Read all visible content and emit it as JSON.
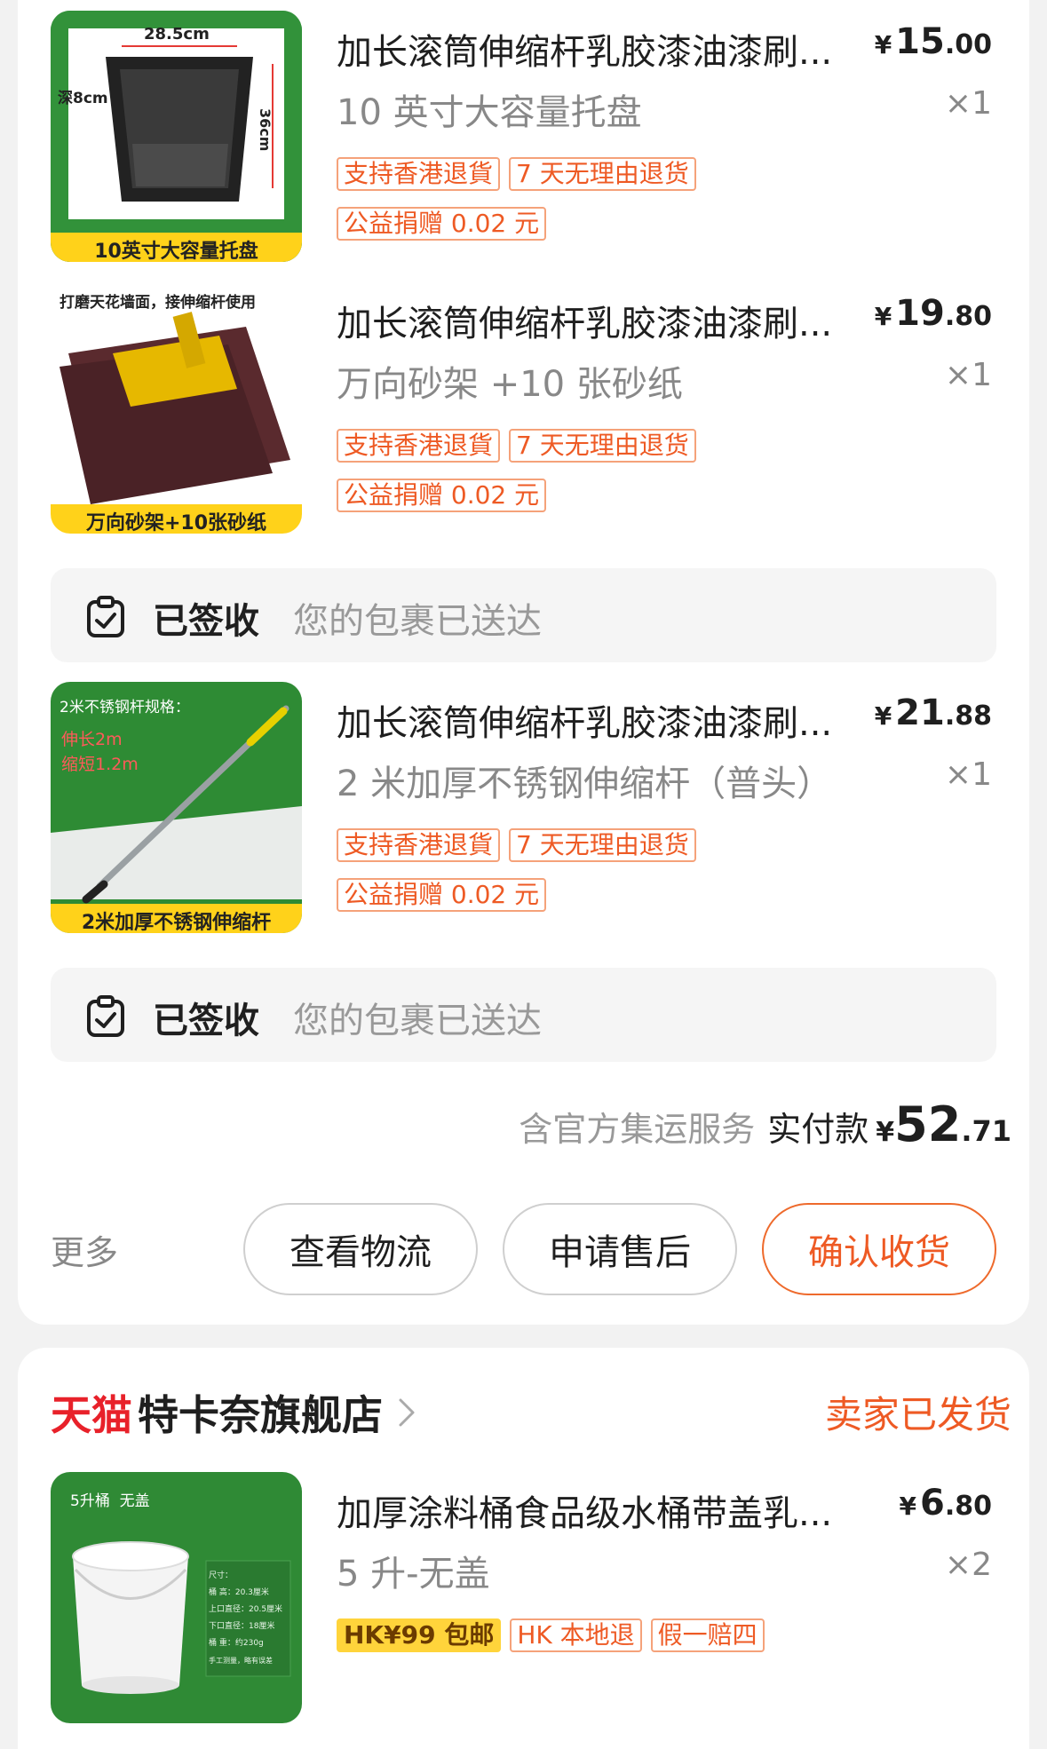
{
  "items": [
    {
      "title": "加长滚筒伸缩杆乳胶漆油漆刷...",
      "price_currency": "¥",
      "price_int": "15",
      "price_dec": ".00",
      "spec": "10 英寸大容量托盘",
      "qty": "×1",
      "tags": [
        "支持香港退貨",
        "7 天无理由退货",
        "公益捐赠 0.02 元"
      ],
      "thumb_text_top": "28.5cm",
      "thumb_text_side": "深8cm",
      "thumb_text_right": "36cm",
      "thumb_caption": "10英寸大容量托盘"
    },
    {
      "title": "加长滚筒伸缩杆乳胶漆油漆刷...",
      "price_currency": "¥",
      "price_int": "19",
      "price_dec": ".80",
      "spec": "万向砂架 +10 张砂纸",
      "qty": "×1",
      "tags": [
        "支持香港退貨",
        "7 天无理由退货",
        "公益捐赠 0.02 元"
      ],
      "thumb_text_top": "打磨天花墙面，接伸缩杆使用",
      "thumb_caption": "万向砂架+10张砂纸"
    },
    {
      "title": "加长滚筒伸缩杆乳胶漆油漆刷...",
      "price_currency": "¥",
      "price_int": "21",
      "price_dec": ".88",
      "spec": "2 米加厚不锈钢伸缩杆（普头）",
      "qty": "×1",
      "tags": [
        "支持香港退貨",
        "7 天无理由退货",
        "公益捐赠 0.02 元"
      ],
      "thumb_text_top": "2米不锈钢杆规格：",
      "thumb_text_l1": "伸长2m",
      "thumb_text_l2": "缩短1.2m",
      "thumb_caption": "2米加厚不锈钢伸缩杆"
    },
    {
      "title": "加厚涂料桶食品级水桶带盖乳...",
      "price_currency": "¥",
      "price_int": "6",
      "price_dec": ".80",
      "spec": "5 升-无盖",
      "qty": "×2",
      "tags": [
        "HK¥99 包邮",
        "HK 本地退",
        "假一赔四"
      ],
      "thumb_text_top": "5升桶  无盖",
      "thumb_size_lines": [
        "尺寸：",
        "桶    高：20.3厘米",
        "上口直径：20.5厘米",
        "下口直径：18厘米",
        "桶    重：约230g",
        "手工测量，略有误差"
      ]
    }
  ],
  "delivery": [
    {
      "status": "已签收",
      "message": "您的包裹已送达"
    },
    {
      "status": "已签收",
      "message": "您的包裹已送达"
    }
  ],
  "order_total": {
    "note": "含官方集运服务",
    "label": "实付款",
    "currency": "¥",
    "int": "52",
    "dec": ".71"
  },
  "actions": {
    "more": "更多",
    "view_logistics": "查看物流",
    "after_sales": "申请售后",
    "confirm_receipt": "确认收货"
  },
  "shop2": {
    "brand": "天猫",
    "name": "特卡奈旗舰店",
    "status": "卖家已发货"
  }
}
